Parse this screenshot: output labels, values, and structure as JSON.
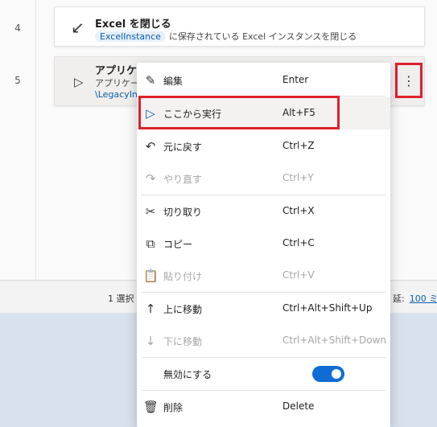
{
  "line_numbers": [
    "4",
    "5"
  ],
  "steps": [
    {
      "icon": "close-arrow-icon",
      "title": "Excel を閉じる",
      "badge": "ExcelInstance",
      "description": "に保存されている Excel インスタンスを閉じる"
    },
    {
      "icon": "run-icon",
      "title": "アプリケー",
      "description": "アプリケーシ",
      "link": "\\LegacyIn"
    }
  ],
  "more_button": {
    "icon": "more-vertical-icon",
    "label": "⋮"
  },
  "status_bar": {
    "selection_text": "1 選択",
    "delay_label": "延:",
    "delay_value": "100 ミ"
  },
  "context_menu": {
    "items": [
      {
        "icon": "edit-icon",
        "glyph": "✎",
        "label": "編集",
        "shortcut": "Enter",
        "disabled": false
      },
      {
        "icon": "run-from-here-icon",
        "glyph": "▷",
        "label": "ここから実行",
        "shortcut": "Alt+F5",
        "disabled": false,
        "active": true
      },
      {
        "icon": "undo-icon",
        "glyph": "↶",
        "label": "元に戻す",
        "shortcut": "Ctrl+Z",
        "disabled": false
      },
      {
        "icon": "redo-icon",
        "glyph": "↷",
        "label": "やり直す",
        "shortcut": "Ctrl+Y",
        "disabled": true
      },
      {
        "icon": "cut-icon",
        "glyph": "✂",
        "label": "切り取り",
        "shortcut": "Ctrl+X",
        "disabled": false
      },
      {
        "icon": "copy-icon",
        "glyph": "⧉",
        "label": "コピー",
        "shortcut": "Ctrl+C",
        "disabled": false
      },
      {
        "icon": "paste-icon",
        "glyph": "📋",
        "label": "貼り付け",
        "shortcut": "Ctrl+V",
        "disabled": true
      },
      {
        "icon": "move-up-icon",
        "glyph": "↑",
        "label": "上に移動",
        "shortcut": "Ctrl+Alt+Shift+Up",
        "disabled": false
      },
      {
        "icon": "move-down-icon",
        "glyph": "↓",
        "label": "下に移動",
        "shortcut": "Ctrl+Alt+Shift+Down",
        "disabled": true
      },
      {
        "label": "無効にする",
        "toggle_on": true
      },
      {
        "icon": "delete-icon",
        "glyph": "🗑",
        "label": "削除",
        "shortcut": "Delete",
        "disabled": false
      }
    ]
  },
  "colors": {
    "accent": "#0f6cd5",
    "highlight_box": "#e0202c",
    "link": "#0b5cad"
  }
}
